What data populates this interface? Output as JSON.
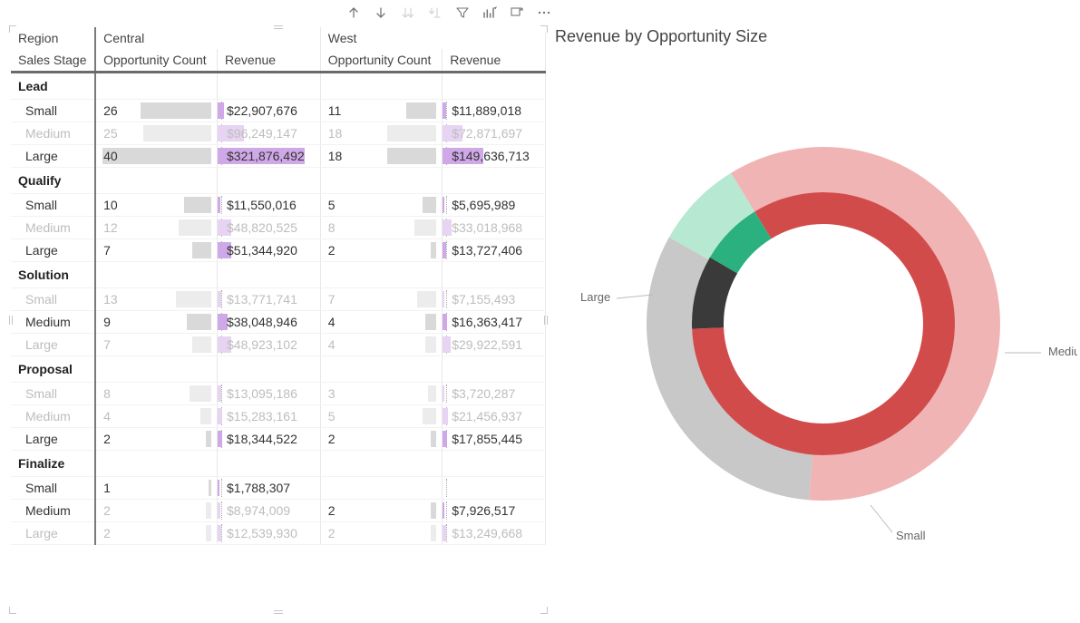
{
  "matrix": {
    "row_headers": [
      "Region",
      "Sales Stage"
    ],
    "regions": [
      "Central",
      "West"
    ],
    "value_cols": [
      "Opportunity Count",
      "Revenue"
    ],
    "max_opp_count": 40,
    "max_revenue": 321876492,
    "groups": [
      {
        "name": "Lead",
        "rows": [
          {
            "label": "Small",
            "dim": false,
            "central": {
              "oc": 26,
              "rev": "$22,907,676",
              "revn": 22907676
            },
            "west": {
              "oc": 11,
              "rev": "$11,889,018",
              "revn": 11889018
            }
          },
          {
            "label": "Medium",
            "dim": true,
            "central": {
              "oc": 25,
              "rev": "$96,249,147",
              "revn": 96249147
            },
            "west": {
              "oc": 18,
              "rev": "$72,871,697",
              "revn": 72871697
            }
          },
          {
            "label": "Large",
            "dim": false,
            "central": {
              "oc": 40,
              "rev": "$321,876,492",
              "revn": 321876492
            },
            "west": {
              "oc": 18,
              "rev": "$149,636,713",
              "revn": 149636713
            }
          }
        ]
      },
      {
        "name": "Qualify",
        "rows": [
          {
            "label": "Small",
            "dim": false,
            "central": {
              "oc": 10,
              "rev": "$11,550,016",
              "revn": 11550016
            },
            "west": {
              "oc": 5,
              "rev": "$5,695,989",
              "revn": 5695989
            }
          },
          {
            "label": "Medium",
            "dim": true,
            "central": {
              "oc": 12,
              "rev": "$48,820,525",
              "revn": 48820525
            },
            "west": {
              "oc": 8,
              "rev": "$33,018,968",
              "revn": 33018968
            }
          },
          {
            "label": "Large",
            "dim": false,
            "central": {
              "oc": 7,
              "rev": "$51,344,920",
              "revn": 51344920
            },
            "west": {
              "oc": 2,
              "rev": "$13,727,406",
              "revn": 13727406
            }
          }
        ]
      },
      {
        "name": "Solution",
        "rows": [
          {
            "label": "Small",
            "dim": true,
            "central": {
              "oc": 13,
              "rev": "$13,771,741",
              "revn": 13771741
            },
            "west": {
              "oc": 7,
              "rev": "$7,155,493",
              "revn": 7155493
            }
          },
          {
            "label": "Medium",
            "dim": false,
            "central": {
              "oc": 9,
              "rev": "$38,048,946",
              "revn": 38048946
            },
            "west": {
              "oc": 4,
              "rev": "$16,363,417",
              "revn": 16363417
            }
          },
          {
            "label": "Large",
            "dim": true,
            "central": {
              "oc": 7,
              "rev": "$48,923,102",
              "revn": 48923102
            },
            "west": {
              "oc": 4,
              "rev": "$29,922,591",
              "revn": 29922591
            }
          }
        ]
      },
      {
        "name": "Proposal",
        "rows": [
          {
            "label": "Small",
            "dim": true,
            "central": {
              "oc": 8,
              "rev": "$13,095,186",
              "revn": 13095186
            },
            "west": {
              "oc": 3,
              "rev": "$3,720,287",
              "revn": 3720287
            }
          },
          {
            "label": "Medium",
            "dim": true,
            "central": {
              "oc": 4,
              "rev": "$15,283,161",
              "revn": 15283161
            },
            "west": {
              "oc": 5,
              "rev": "$21,456,937",
              "revn": 21456937
            }
          },
          {
            "label": "Large",
            "dim": false,
            "central": {
              "oc": 2,
              "rev": "$18,344,522",
              "revn": 18344522
            },
            "west": {
              "oc": 2,
              "rev": "$17,855,445",
              "revn": 17855445
            }
          }
        ]
      },
      {
        "name": "Finalize",
        "rows": [
          {
            "label": "Small",
            "dim": false,
            "central": {
              "oc": 1,
              "rev": "$1,788,307",
              "revn": 1788307
            },
            "west": {
              "oc": null,
              "rev": "",
              "revn": 0
            }
          },
          {
            "label": "Medium",
            "dim2": true,
            "central": {
              "oc": 2,
              "rev": "$8,974,009",
              "revn": 8974009,
              "dim": true
            },
            "west": {
              "oc": 2,
              "rev": "$7,926,517",
              "revn": 7926517
            }
          },
          {
            "label": "Large",
            "dim": true,
            "central": {
              "oc": 2,
              "rev": "$12,539,930",
              "revn": 12539930
            },
            "west": {
              "oc": 2,
              "rev": "$13,249,668",
              "revn": 13249668
            }
          }
        ]
      }
    ]
  },
  "chart": {
    "title": "Revenue by Opportunity Size",
    "legend": {
      "large": "Large",
      "medium": "Medium",
      "small": "Small"
    }
  },
  "chart_data": {
    "type": "pie",
    "title": "Revenue by Opportunity Size",
    "note": "Double ring: outer = total (dim), inner = highlighted subset",
    "series": [
      {
        "name": "Large (total)",
        "ring": "outer",
        "value": 677421199,
        "color": "#f1b4b4"
      },
      {
        "name": "Medium (total)",
        "ring": "outer",
        "value": 359012824,
        "color": "#c8c8c8"
      },
      {
        "name": "Small (total)",
        "ring": "outer",
        "value": 91573813,
        "color": "#b7e8d2"
      },
      {
        "name": "Large (highlighted)",
        "ring": "inner",
        "value": 572785498,
        "color": "#d24b4b"
      },
      {
        "name": "Medium (highlighted)",
        "ring": "inner",
        "value": 62338880,
        "color": "#3a3a3a"
      },
      {
        "name": "Small (highlighted)",
        "ring": "inner",
        "value": 53831006,
        "color": "#2bb080"
      }
    ],
    "inner_radius_pct": 55
  }
}
